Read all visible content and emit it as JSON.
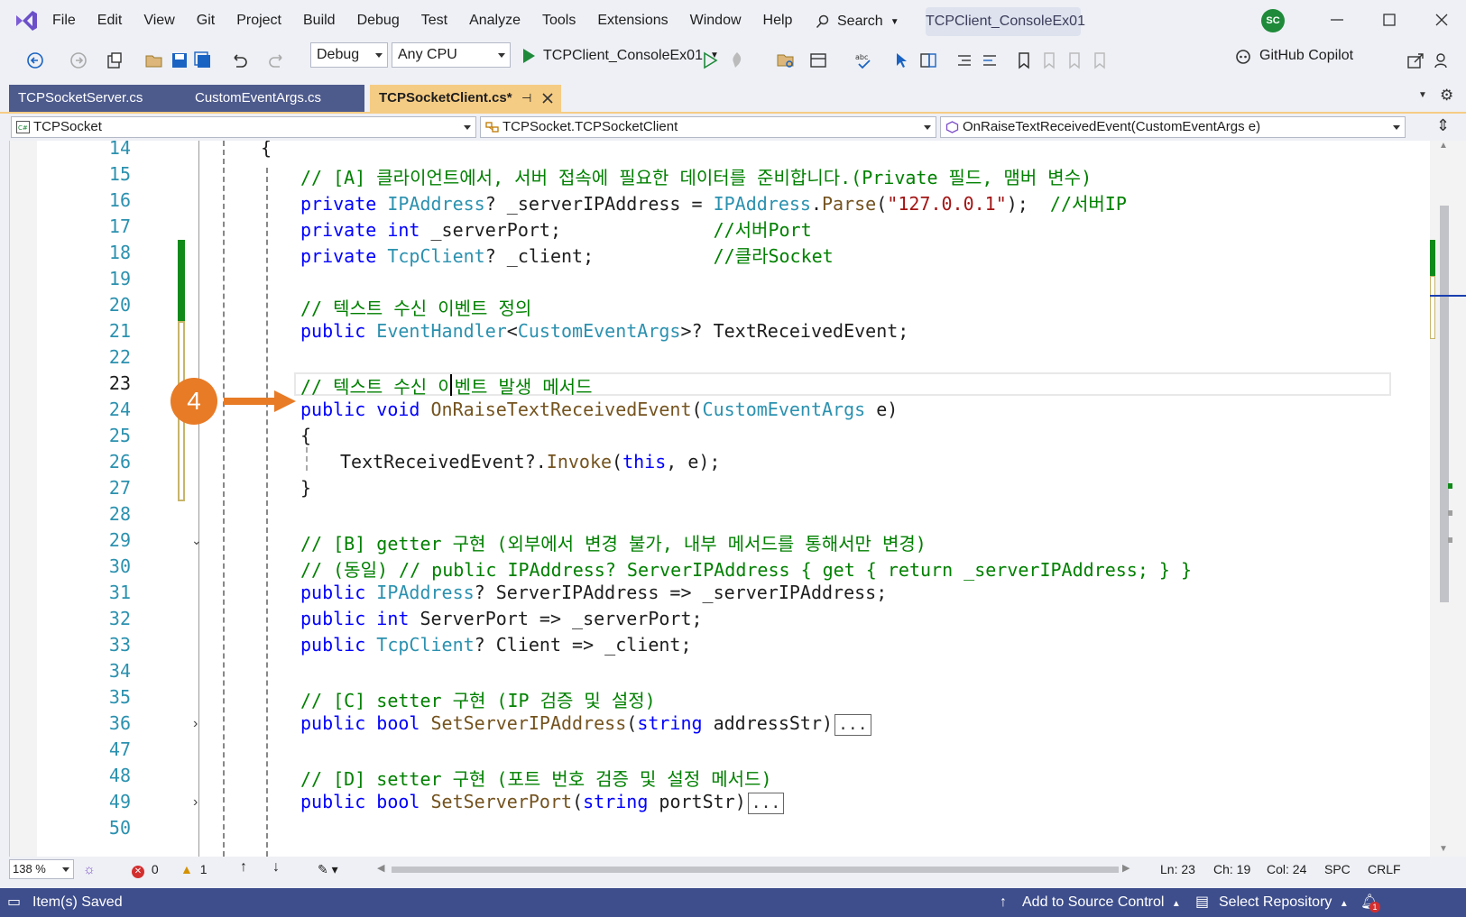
{
  "menu": [
    "File",
    "Edit",
    "View",
    "Git",
    "Project",
    "Build",
    "Debug",
    "Test",
    "Analyze",
    "Tools",
    "Extensions",
    "Window",
    "Help"
  ],
  "search_label": "Search",
  "solution_title": "TCPClient_ConsoleEx01",
  "avatar_initials": "SC",
  "toolbar": {
    "config": "Debug",
    "platform": "Any CPU",
    "run_target": "TCPClient_ConsoleEx01",
    "copilot": "GitHub Copilot"
  },
  "tabs": [
    {
      "label": "TCPSocketServer.cs",
      "active": false
    },
    {
      "label": "CustomEventArgs.cs",
      "active": false
    },
    {
      "label": "TCPSocketClient.cs*",
      "active": true
    }
  ],
  "navbar": {
    "project": "TCPSocket",
    "type": "TCPSocket.TCPSocketClient",
    "member": "OnRaiseTextReceivedEvent(CustomEventArgs e)"
  },
  "line_numbers": [
    "14",
    "15",
    "16",
    "17",
    "18",
    "19",
    "20",
    "21",
    "22",
    "23",
    "24",
    "25",
    "26",
    "27",
    "28",
    "29",
    "30",
    "31",
    "32",
    "33",
    "34",
    "35",
    "36",
    "47",
    "48",
    "49",
    "50"
  ],
  "current_line": "23",
  "code": {
    "l14": "{",
    "l15": "// [A] 클라이언트에서, 서버 접속에 필요한 데이터를 준비합니다.(Private 필드, 맴버 변수)",
    "l16_kw": "private",
    "l16_ty": "IPAddress",
    "l16_rest": "? _serverIPAddress = ",
    "l16_ty2": "IPAddress",
    "l16_dot": ".",
    "l16_mt": "Parse",
    "l16_p1": "(",
    "l16_st": "\"127.0.0.1\"",
    "l16_p2": ");  ",
    "l16_cm": "//서버IP",
    "l17_kw": "private",
    "l17_kw2": "int",
    "l17_rest": " _serverPort;              ",
    "l17_cm": "//서버Port",
    "l18_kw": "private",
    "l18_ty": "TcpClient",
    "l18_rest": "? _client;           ",
    "l18_cm": "//클라Socket",
    "l20": "// 텍스트 수신 이벤트 정의",
    "l21_kw": "public",
    "l21_ty": "EventHandler",
    "l21_lt": "<",
    "l21_ty2": "CustomEventArgs",
    "l21_rest": ">? TextReceivedEvent;",
    "l23": "// 텍스트 수신 이벤트 발생 메서드",
    "l24_kw": "public",
    "l24_kw2": "void",
    "l24_mt": "OnRaiseTextReceivedEvent",
    "l24_p": "(",
    "l24_ty": "CustomEventArgs",
    "l24_rest": " e)",
    "l25": "{",
    "l26_a": "TextReceivedEvent?.",
    "l26_mt": "Invoke",
    "l26_p": "(",
    "l26_kw": "this",
    "l26_rest": ", e);",
    "l27": "}",
    "l29": "// [B] getter 구현 (외부에서 변경 불가, 내부 메서드를 통해서만 변경)",
    "l30": "// (동일) // public IPAddress? ServerIPAddress { get { return _serverIPAddress; } }",
    "l31_kw": "public",
    "l31_ty": "IPAddress",
    "l31_rest": "? ServerIPAddress => _serverIPAddress;",
    "l32_kw": "public",
    "l32_kw2": "int",
    "l32_rest": " ServerPort => _serverPort;",
    "l33_kw": "public",
    "l33_ty": "TcpClient",
    "l33_rest": "? Client => _client;",
    "l35": "// [C] setter 구현 (IP 검증 및 설정)",
    "l36_kw": "public",
    "l36_kw2": "bool",
    "l36_mt": "SetServerIPAddress",
    "l36_p": "(",
    "l36_kw3": "string",
    "l36_rest": " addressStr)",
    "l48": "// [D] setter 구현 (포트 번호 검증 및 설정 메서드)",
    "l49_kw": "public",
    "l49_kw2": "bool",
    "l49_mt": "SetServerPort",
    "l49_p": "(",
    "l49_kw3": "string",
    "l49_rest": " portStr)",
    "collapsed": "..."
  },
  "annotation_step": "4",
  "edit_status": {
    "zoom": "138 %",
    "errors": "0",
    "warnings": "1",
    "ln": "Ln: 23",
    "ch": "Ch: 19",
    "col": "Col: 24",
    "spc": "SPC",
    "crlf": "CRLF"
  },
  "statusbar": {
    "message": "Item(s) Saved",
    "source_control": "Add to Source Control",
    "repository": "Select Repository",
    "notifications": "1"
  },
  "colors": {
    "accent_tab": "#f5cc84",
    "status_bar": "#3e4e8c",
    "annotation": "#e87b26",
    "keyword": "#0000ff",
    "type": "#2b91af",
    "comment": "#008000",
    "string": "#a31515"
  }
}
